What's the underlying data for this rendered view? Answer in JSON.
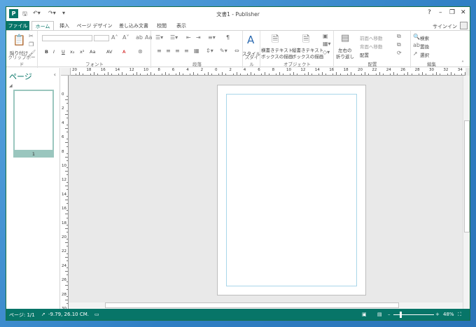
{
  "window": {
    "title": "文書1 - Publisher",
    "app_icon": "publisher-icon",
    "accent": "#077568"
  },
  "qat": {
    "save": "save-icon",
    "undo": "undo-icon",
    "redo": "redo-icon",
    "customize": "customize-qat-icon"
  },
  "controls": {
    "help": "?",
    "minimize": "–",
    "restore": "❐",
    "close": "✕"
  },
  "tabs": [
    "ファイル",
    "ホーム",
    "挿入",
    "ページ デザイン",
    "差し込み文書",
    "校閲",
    "表示"
  ],
  "signin": "サインイン",
  "ribbon": {
    "clipboard": {
      "paste": "貼り付け",
      "label": "クリップボード"
    },
    "font": {
      "label": "フォント",
      "bold": "B",
      "italic": "I",
      "underline": "U",
      "sub": "x₂",
      "sup": "x²",
      "spacing": "AV",
      "case": "Aa",
      "color": "A"
    },
    "paragraph": {
      "label": "段落"
    },
    "styles": {
      "button": "スタイル",
      "label": "スタイル"
    },
    "objects": {
      "h_text": "横書きテキスト",
      "h_text2": "ボックスの描画",
      "v_text": "縦書きテキスト",
      "v_text2": "ボックスの描画",
      "label": "オブジェクト"
    },
    "arrange": {
      "wrap": "左右の",
      "wrap2": "折り返し",
      "forward": "前面へ移動",
      "backward": "背面へ移動",
      "align": "配置",
      "label": "配置"
    },
    "editing": {
      "find": "検索",
      "replace": "置換",
      "select": "選択",
      "label": "編集"
    }
  },
  "pages_pane": {
    "title": "ページ",
    "thumb_number": "1"
  },
  "ruler_h": [
    "20",
    "18",
    "16",
    "14",
    "12",
    "10",
    "8",
    "6",
    "4",
    "2",
    "0",
    "2",
    "4",
    "6",
    "8",
    "10",
    "12",
    "14",
    "16",
    "18",
    "20",
    "22",
    "24",
    "26",
    "28",
    "30",
    "32",
    "34"
  ],
  "ruler_v": [
    "0",
    "2",
    "4",
    "6",
    "8",
    "10",
    "12",
    "14",
    "16",
    "18",
    "20",
    "22",
    "24",
    "26",
    "28",
    "30"
  ],
  "status": {
    "page": "ページ: 1/1",
    "position": "-9.79, 26.10 CM.",
    "zoom": "48%"
  }
}
